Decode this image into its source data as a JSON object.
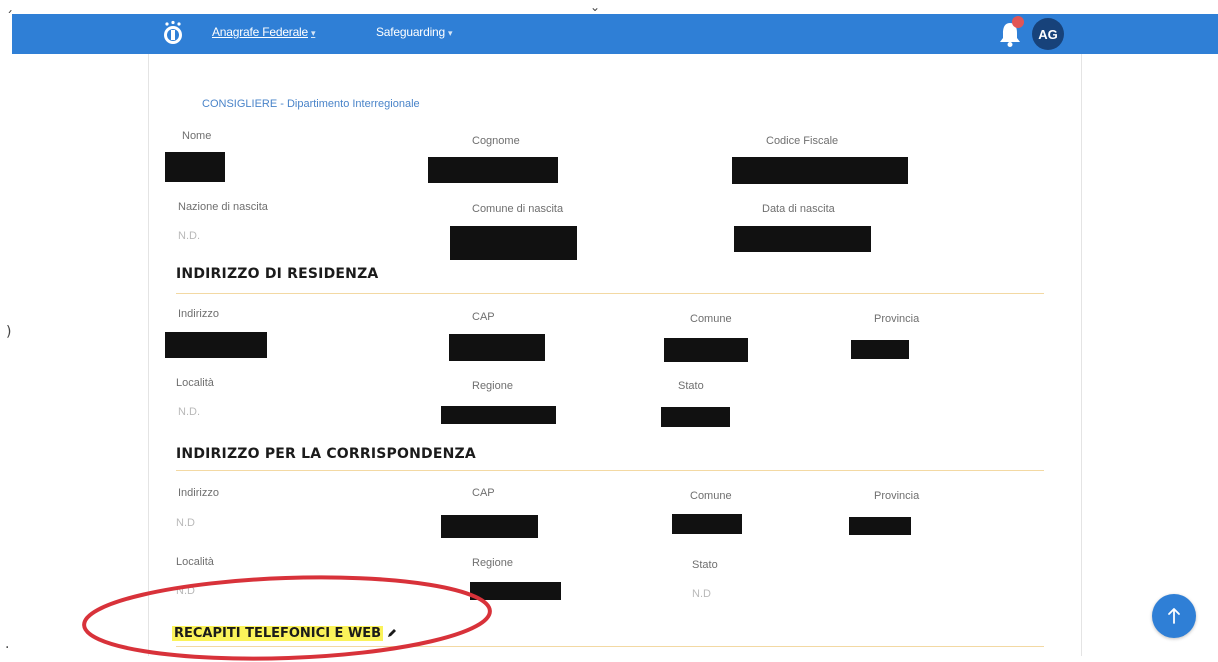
{
  "nav": {
    "items": [
      {
        "label": "Anagrafe Federale"
      },
      {
        "label": "Safeguarding"
      }
    ],
    "avatar": "AG",
    "bar_color": "#2f7fd6",
    "icons": [
      "federation-logo-icon",
      "bell-icon",
      "chevron-down-icon"
    ]
  },
  "breadcrumb": "CONSIGLIERE - Dipartimento Interregionale",
  "personal": {
    "labels": {
      "nome": "Nome",
      "cognome": "Cognome",
      "codice_fiscale": "Codice Fiscale",
      "nazione": "Nazione di nascita",
      "comune": "Comune di nascita",
      "data": "Data di nascita"
    },
    "nazione_value": "N.D."
  },
  "residenza": {
    "title": "INDIRIZZO DI RESIDENZA",
    "labels": {
      "indirizzo": "Indirizzo",
      "cap": "CAP",
      "comune": "Comune",
      "provincia": "Provincia",
      "localita": "Località",
      "regione": "Regione",
      "stato": "Stato"
    },
    "localita_value": "N.D."
  },
  "corrispondenza": {
    "title": "INDIRIZZO PER LA CORRISPONDENZA",
    "labels": {
      "indirizzo": "Indirizzo",
      "cap": "CAP",
      "comune": "Comune",
      "provincia": "Provincia",
      "localita": "Località",
      "regione": "Regione",
      "stato": "Stato"
    },
    "indirizzo_value": "N.D",
    "localita_value": "N.D",
    "stato_value": "N.D"
  },
  "recapiti": {
    "title": "RECAPITI TELEFONICI E WEB"
  },
  "colors": {
    "accent": "#2f7fd6",
    "highlight": "#fbf35a",
    "annotation": "#d8323a",
    "section_rule": "#f3d9a3"
  }
}
